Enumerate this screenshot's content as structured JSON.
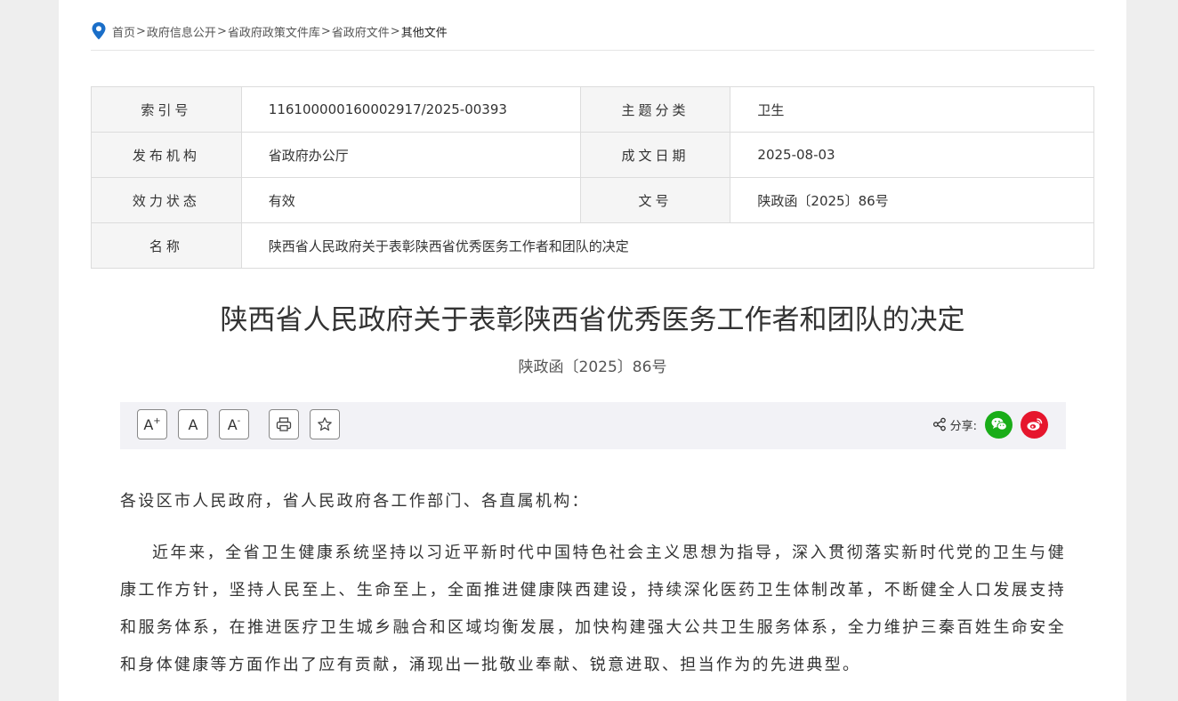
{
  "breadcrumb": {
    "items": [
      "首页",
      "政府信息公开",
      "省政府政策文件库",
      "省政府文件",
      "其他文件"
    ],
    "separator": ">"
  },
  "meta": {
    "index_label": "索引号",
    "index_value": "116100000160002917/2025-00393",
    "category_label": "主题分类",
    "category_value": "卫生",
    "issuer_label": "发布机构",
    "issuer_value": "省政府办公厅",
    "date_label": "成文日期",
    "date_value": "2025-08-03",
    "status_label": "效力状态",
    "status_value": "有效",
    "docno_label": "文号",
    "docno_value": "陕政函〔2025〕86号",
    "name_label": "名称",
    "name_value": "陕西省人民政府关于表彰陕西省优秀医务工作者和团队的决定"
  },
  "title": "陕西省人民政府关于表彰陕西省优秀医务工作者和团队的决定",
  "doc_number": "陕政函〔2025〕86号",
  "toolbar": {
    "font_increase": "A",
    "font_increase_mark": "+",
    "font_default": "A",
    "font_decrease": "A",
    "font_decrease_mark": "-",
    "share_label": "分享:"
  },
  "content": {
    "salutation": "各设区市人民政府，省人民政府各工作部门、各直属机构：",
    "paragraph1": "近年来，全省卫生健康系统坚持以习近平新时代中国特色社会主义思想为指导，深入贯彻落实新时代党的卫生与健康工作方针，坚持人民至上、生命至上，全面推进健康陕西建设，持续深化医药卫生体制改革，不断健全人口发展支持和服务体系，在推进医疗卫生城乡融合和区域均衡发展，加快构建强大公共卫生服务体系，全力维护三秦百姓生命安全和身体健康等方面作出了应有贡献，涌现出一批敬业奉献、锐意进取、担当作为的先进典型。"
  },
  "colors": {
    "wechat": "#1aad19",
    "weibo": "#e6162d",
    "location_pin": "#1a6ec8"
  }
}
